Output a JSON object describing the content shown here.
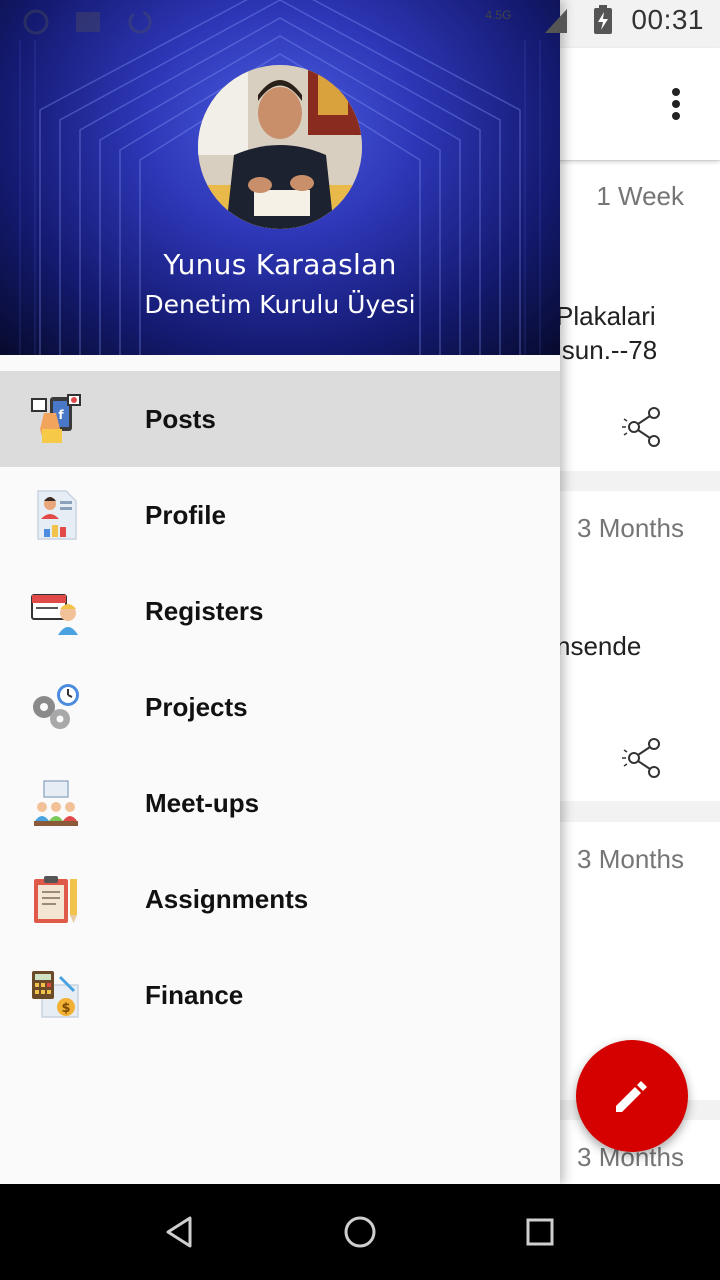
{
  "status_bar": {
    "network": "4.5G",
    "time": "00:31"
  },
  "drawer": {
    "user_name": "Yunus Karaaslan",
    "user_role": "Denetim Kurulu Üyesi",
    "menu": [
      {
        "label": "Posts",
        "icon": "posts-icon",
        "active": true
      },
      {
        "label": "Profile",
        "icon": "profile-icon",
        "active": false
      },
      {
        "label": "Registers",
        "icon": "registers-icon",
        "active": false
      },
      {
        "label": "Projects",
        "icon": "projects-icon",
        "active": false
      },
      {
        "label": "Meet-ups",
        "icon": "meetups-icon",
        "active": false
      },
      {
        "label": "Assignments",
        "icon": "assignments-icon",
        "active": false
      },
      {
        "label": "Finance",
        "icon": "finance-icon",
        "active": false
      }
    ]
  },
  "feed": {
    "cards": [
      {
        "time": "1 Week",
        "text_line1": "Plakalari",
        "text_line2": "lsun.--78"
      },
      {
        "time": "3 Months",
        "text_line1": "nsende",
        "text_line2": ""
      },
      {
        "time": "3 Months",
        "text_line1": "",
        "text_line2": ""
      },
      {
        "time": "3 Months",
        "text_line1": "",
        "text_line2": ""
      }
    ]
  },
  "colors": {
    "fab": "#d50000",
    "header_accent": "#2d36b6",
    "active_item_bg": "#dcdcdc"
  },
  "icons": {
    "fab": "pencil-icon",
    "share": "share-icon",
    "overflow": "more-vert-icon"
  }
}
